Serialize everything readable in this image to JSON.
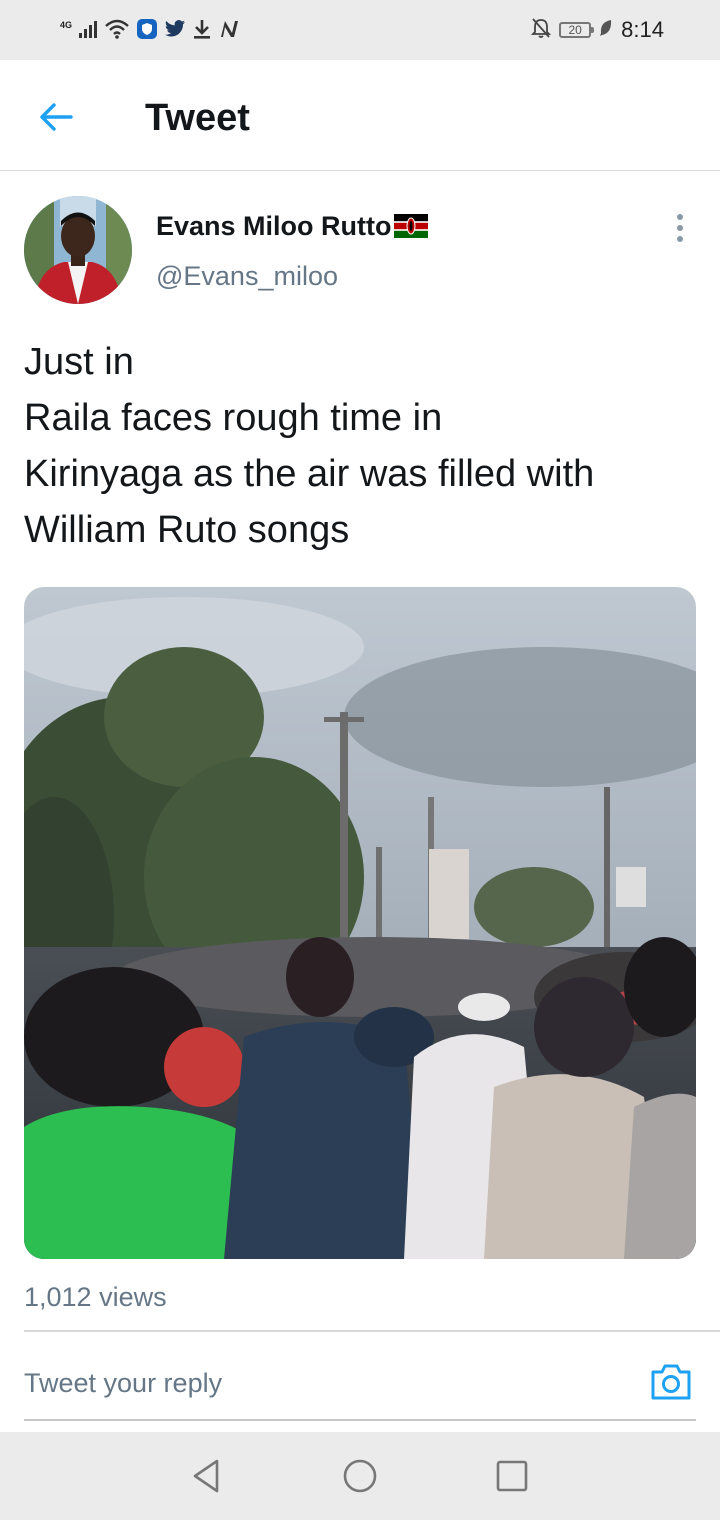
{
  "status_bar": {
    "network": "4G",
    "time": "8:14",
    "battery": "20",
    "icons": [
      "signal-icon",
      "wifi-icon",
      "shield-app-icon",
      "twitter-bird-icon",
      "download-icon",
      "n-app-icon",
      "bell-muted-icon",
      "battery-icon",
      "leaf-icon"
    ]
  },
  "header": {
    "title": "Tweet",
    "back_icon": "arrow-left-icon"
  },
  "tweet": {
    "author_name": "Evans Miloo Rutto",
    "author_flag": "kenya-flag-icon",
    "author_handle": "@Evans_miloo",
    "text_lines": [
      "Just in",
      "Raila faces rough time in",
      "Kirinyaga as the air was filled with",
      "William Ruto songs"
    ],
    "views": "1,012 views"
  },
  "reply": {
    "placeholder": "Tweet your reply",
    "camera_icon": "camera-icon"
  },
  "colors": {
    "accent": "#1da1f2",
    "secondary_text": "#657786",
    "primary_text": "#14171a"
  },
  "nav_bar": {
    "icons": [
      "back-triangle-icon",
      "home-circle-icon",
      "recents-square-icon"
    ]
  }
}
